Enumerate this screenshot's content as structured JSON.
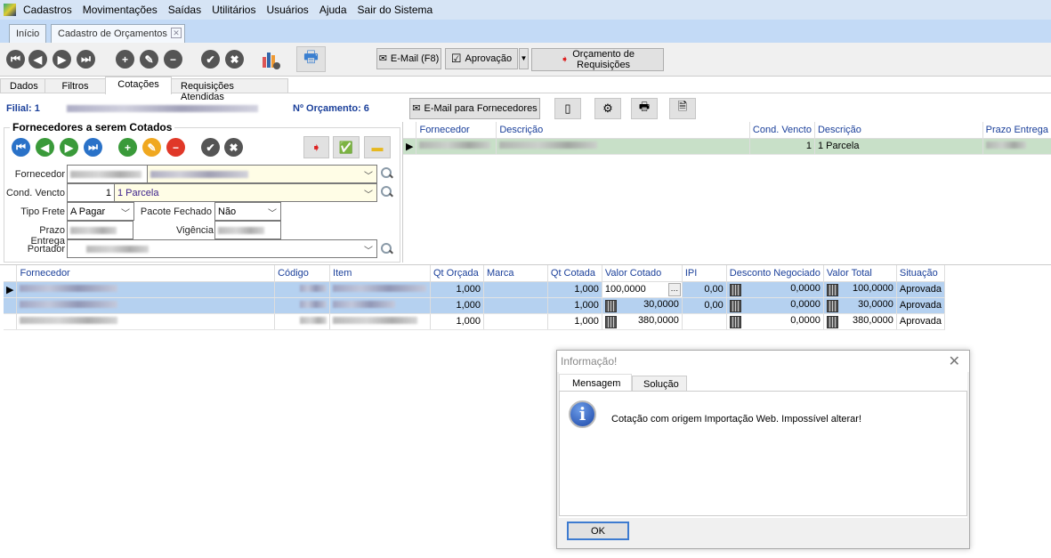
{
  "menu": [
    "Cadastros",
    "Movimentações",
    "Saídas",
    "Utilitários",
    "Usuários",
    "Ajuda",
    "Sair do Sistema"
  ],
  "doc_tabs": {
    "home": "Início",
    "active": "Cadastro de Orçamentos"
  },
  "toolbar": {
    "email": "E-Mail (F8)",
    "approval": "Aprovação",
    "requisitions_line1": "Orçamento de",
    "requisitions_line2": "Requisições"
  },
  "page_tabs": [
    "Dados",
    "Filtros",
    "Cotações",
    "Requisições Atendidas"
  ],
  "header": {
    "filial": "Filial: 1",
    "orcamento": "Nº Orçamento: 6",
    "email_suppliers": "E-Mail para Fornecedores"
  },
  "form": {
    "title": "Fornecedores a serem Cotados",
    "fornecedor_label": "Fornecedor",
    "cond_label": "Cond. Vencto",
    "cond_code": "1",
    "cond_desc": "1 Parcela",
    "frete_label": "Tipo Frete",
    "frete_value": "A Pagar",
    "pacote_label": "Pacote Fechado",
    "pacote_value": "Não",
    "prazo_label": "Prazo Entrega",
    "vigencia_label": "Vigência",
    "portador_label": "Portador"
  },
  "supplier_grid": {
    "headers": [
      "Fornecedor",
      "Descrição",
      "Cond. Vencto",
      "Descrição",
      "Prazo Entrega"
    ],
    "row": {
      "cond": "1",
      "desc": "1 Parcela"
    }
  },
  "items_grid": {
    "headers": [
      "Fornecedor",
      "Código",
      "Item",
      "Qt Orçada",
      "Marca",
      "Qt Cotada",
      "Valor Cotado",
      "IPI",
      "Desconto Negociado",
      "Valor Total",
      "Situação"
    ],
    "rows": [
      {
        "qt_orcada": "1,000",
        "qt_cotada": "1,000",
        "valor_cotado": "100,0000",
        "ipi": "0,00",
        "desconto": "0,0000",
        "total": "100,0000",
        "situacao": "Aprovada"
      },
      {
        "qt_orcada": "1,000",
        "qt_cotada": "1,000",
        "valor_cotado": "30,0000",
        "ipi": "0,00",
        "desconto": "0,0000",
        "total": "30,0000",
        "situacao": "Aprovada"
      },
      {
        "qt_orcada": "1,000",
        "qt_cotada": "1,000",
        "valor_cotado": "380,0000",
        "ipi": "",
        "desconto": "0,0000",
        "total": "380,0000",
        "situacao": "Aprovada"
      }
    ]
  },
  "dialog": {
    "title": "Informação!",
    "tabs": [
      "Mensagem",
      "Solução"
    ],
    "message": "Cotação com origem Importação Web. Impossível alterar!",
    "ok": "OK"
  },
  "colors": {
    "menubar": "#d6e4f5",
    "selected_row": "#b5d1f0",
    "green_row": "#c8e0c8"
  }
}
